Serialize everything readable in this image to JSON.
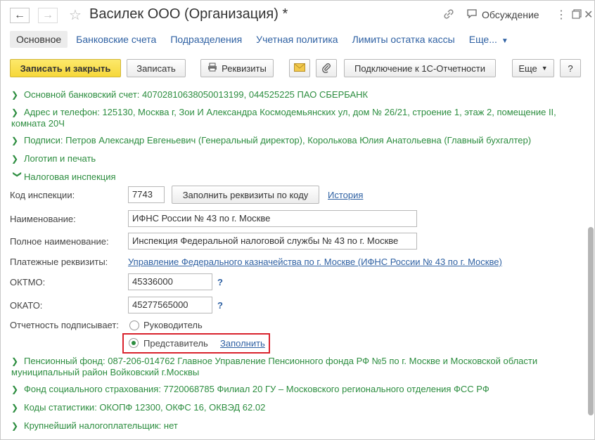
{
  "window": {
    "title": "Василек ООО (Организация) *",
    "discussion_label": "Обсуждение"
  },
  "tabs": [
    {
      "label": "Основное"
    },
    {
      "label": "Банковские счета"
    },
    {
      "label": "Подразделения"
    },
    {
      "label": "Учетная политика"
    },
    {
      "label": "Лимиты остатка кассы"
    },
    {
      "label": "Еще..."
    }
  ],
  "toolbar": {
    "save_close": "Записать и закрыть",
    "save": "Записать",
    "requisites": "Реквизиты",
    "connect": "Подключение к 1С-Отчетности",
    "more": "Еще",
    "help": "?"
  },
  "groups": {
    "bank": "Основной банковский счет: 40702810638050013199, 044525225 ПАО СБЕРБАНК",
    "address": "Адрес и телефон: 125130, Москва г, Зои И Александра Космодемьянских ул, дом № 26/21, строение 1, этаж 2, помещение II, комната 20Ч",
    "signatures": "Подписи: Петров Александр Евгеньевич (Генеральный директор), Королькова Юлия Анатольевна (Главный бухгалтер)",
    "logo": "Логотип и печать",
    "tax": "Налоговая инспекция",
    "pension": "Пенсионный фонд: 087-206-014762 Главное Управление Пенсионного фонда РФ №5 по г. Москве и Московской области муниципальный район Войковский г.Москвы",
    "fss": "Фонд социального страхования: 7720068785 Филиал 20 ГУ – Московского регионального отделения ФСС РФ",
    "stats": "Коды статистики: ОКОПФ 12300, ОКФС 16, ОКВЭД 62.02",
    "largest": "Крупнейший налогоплательщик: нет"
  },
  "tax": {
    "code_label": "Код инспекции:",
    "code_value": "7743",
    "fill_button": "Заполнить реквизиты по коду",
    "history_link": "История",
    "name_label": "Наименование:",
    "name_value": "ИФНС России № 43 по г. Москве",
    "full_name_label": "Полное наименование:",
    "full_name_value": "Инспекция Федеральной налоговой службы № 43 по г. Москве",
    "payment_label": "Платежные реквизиты:",
    "payment_link": "Управление Федерального казначейства по г. Москве (ИФНС России № 43 по г. Москве)",
    "oktmo_label": "ОКТМО:",
    "oktmo_value": "45336000",
    "okato_label": "ОКАТО:",
    "okato_value": "45277565000",
    "qmark": "?",
    "signer_label": "Отчетность подписывает:",
    "signer_option_head": "Руководитель",
    "signer_option_rep": "Представитель",
    "fill_link": "Заполнить",
    "selected": "Представитель"
  },
  "colors": {
    "group_green": "#2c8d3f",
    "link_blue": "#2f61a3",
    "primary_yellow": "#f6d73a",
    "highlight_red": "#d9232d"
  }
}
